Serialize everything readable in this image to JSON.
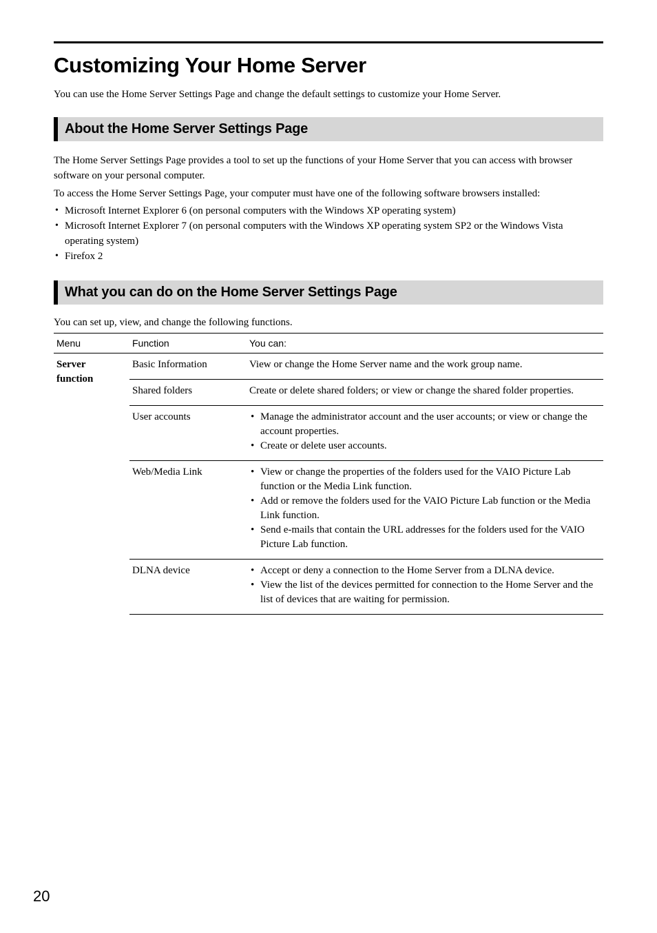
{
  "title": "Customizing Your Home Server",
  "intro": "You can use the Home Server Settings Page and change the default settings to customize your Home Server.",
  "section1": {
    "heading": "About the Home Server Settings Page",
    "p1": "The Home Server Settings Page provides a tool to set up the functions of your Home Server that you can access with browser software on your personal computer.",
    "p2": "To access the Home Server Settings Page, your computer must have one of the following software browsers installed:",
    "bullets": [
      "Microsoft Internet Explorer 6 (on personal computers with the Windows XP operating system)",
      "Microsoft Internet Explorer 7 (on personal computers with the Windows XP operating system SP2  or the Windows Vista operating system)",
      "Firefox 2"
    ]
  },
  "section2": {
    "heading": "What you can do on the Home Server Settings Page",
    "caption": "You can set up, view, and change the following functions.",
    "headers": {
      "menu": "Menu",
      "func": "Function",
      "you": "You can:"
    },
    "menu_label_1": "Server",
    "menu_label_2": "function",
    "rows": [
      {
        "func": "Basic Information",
        "plain": "View or change the Home Server name and the work group name."
      },
      {
        "func": "Shared folders",
        "plain": "Create or delete shared folders; or view or change the shared folder properties."
      },
      {
        "func": "User accounts",
        "bullets": [
          "Manage the administrator account and the user accounts; or view or change the account properties.",
          "Create or delete user accounts."
        ]
      },
      {
        "func": "Web/Media Link",
        "bullets": [
          "View or change the properties of the folders used for the VAIO Picture Lab function or the Media Link function.",
          "Add or remove the folders used for the VAIO Picture Lab function or the Media Link function.",
          "Send e-mails that contain the URL addresses for the folders used for the VAIO Picture Lab function."
        ]
      },
      {
        "func": "DLNA device",
        "bullets": [
          "Accept or deny  a connection to the Home Server from a DLNA device.",
          "View the list of the devices permitted for connection to the Home Server and the list of devices that are waiting for permission."
        ]
      }
    ]
  },
  "page_number": "20"
}
